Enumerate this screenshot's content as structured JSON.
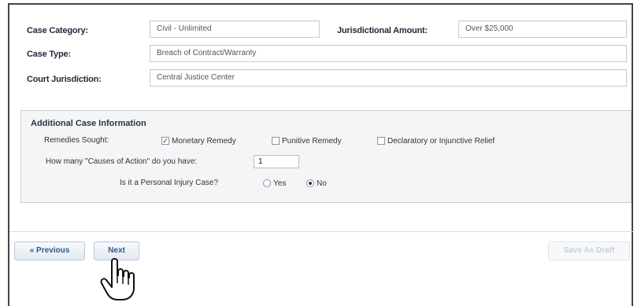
{
  "case": {
    "category_label": "Case Category:",
    "category_value": "Civil - Unlimited",
    "jurisdictional_amount_label": "Jurisdictional Amount:",
    "jurisdictional_amount_value": "Over $25,000",
    "type_label": "Case Type:",
    "type_value": "Breach of Contract/Warranty",
    "court_label": "Court Jurisdiction:",
    "court_value": "Central Justice Center"
  },
  "additional": {
    "title": "Additional Case Information",
    "remedies_label": "Remedies Sought:",
    "remedies": [
      {
        "label": "Monetary Remedy",
        "checked": true
      },
      {
        "label": "Punitive Remedy",
        "checked": false
      },
      {
        "label": "Declaratory or Injunctive Relief",
        "checked": false
      }
    ],
    "causes_label": "How many \"Causes of Action\" do you have:",
    "causes_value": "1",
    "personal_injury_label": "Is it a Personal Injury Case?",
    "personal_injury_options": [
      {
        "label": "Yes",
        "selected": false
      },
      {
        "label": "No",
        "selected": true
      }
    ]
  },
  "buttons": {
    "previous": "« Previous",
    "next": "Next",
    "save_draft": "Save As Draft"
  },
  "icons": {
    "cursor": "hand-pointer-icon"
  }
}
